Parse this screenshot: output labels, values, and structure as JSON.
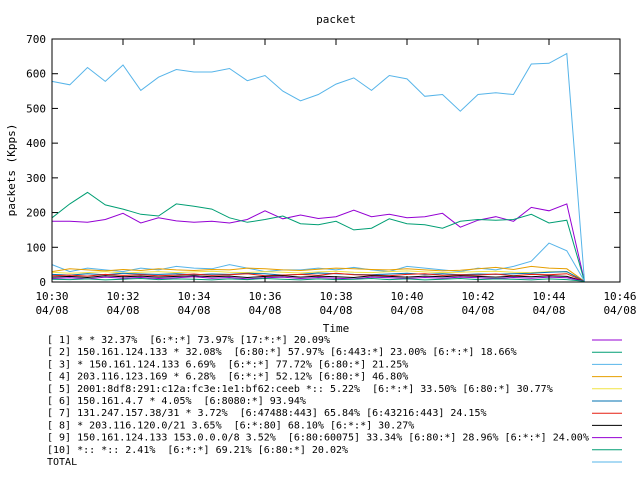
{
  "chart_data": {
    "type": "line",
    "title": "packet",
    "xlabel": "Time",
    "ylabel": "packets (Kpps)",
    "ylim": [
      0,
      700
    ],
    "yticks": [
      0,
      100,
      200,
      300,
      400,
      500,
      600,
      700
    ],
    "xlim": [
      0,
      16
    ],
    "xticks": [
      {
        "x": 0,
        "time": "10:30",
        "date": "04/08"
      },
      {
        "x": 2,
        "time": "10:32",
        "date": "04/08"
      },
      {
        "x": 4,
        "time": "10:34",
        "date": "04/08"
      },
      {
        "x": 6,
        "time": "10:36",
        "date": "04/08"
      },
      {
        "x": 8,
        "time": "10:38",
        "date": "04/08"
      },
      {
        "x": 10,
        "time": "10:40",
        "date": "04/08"
      },
      {
        "x": 12,
        "time": "10:42",
        "date": "04/08"
      },
      {
        "x": 14,
        "time": "10:44",
        "date": "04/08"
      },
      {
        "x": 16,
        "time": "10:46",
        "date": "04/08"
      }
    ],
    "x": [
      0,
      0.5,
      1,
      1.5,
      2,
      2.5,
      3,
      3.5,
      4,
      4.5,
      5,
      5.5,
      6,
      6.5,
      7,
      7.5,
      8,
      8.5,
      9,
      9.5,
      10,
      10.5,
      11,
      11.5,
      12,
      12.5,
      13,
      13.5,
      14,
      14.5,
      15
    ],
    "grid": false,
    "legend_position": "below",
    "series": [
      {
        "name": "[ 1] * * 32.37%  [6:*:*] 73.97% [17:*:*] 20.09%",
        "color": "#9400d3",
        "values": [
          175,
          175,
          172,
          180,
          198,
          170,
          185,
          176,
          172,
          175,
          170,
          180,
          205,
          182,
          193,
          183,
          188,
          207,
          188,
          195,
          185,
          188,
          198,
          158,
          178,
          188,
          175,
          215,
          205,
          225,
          2
        ]
      },
      {
        "name": "[ 2] 150.161.124.133 * 32.08%  [6:80:*] 57.97% [6:443:*] 23.00% [6:*:*] 18.66%",
        "color": "#009e73",
        "values": [
          185,
          225,
          258,
          222,
          210,
          195,
          190,
          225,
          218,
          210,
          185,
          172,
          180,
          190,
          168,
          165,
          175,
          150,
          155,
          182,
          168,
          165,
          155,
          175,
          180,
          178,
          180,
          195,
          170,
          178,
          2
        ]
      },
      {
        "name": "[ 3] * 150.161.124.133 6.69%  [6:*:*] 77.72% [6:80:*] 21.25%",
        "color": "#56b4e9",
        "values": [
          50,
          30,
          40,
          35,
          30,
          40,
          35,
          45,
          40,
          38,
          50,
          40,
          30,
          35,
          35,
          40,
          35,
          42,
          35,
          30,
          45,
          40,
          35,
          30,
          40,
          35,
          45,
          60,
          112,
          90,
          2
        ]
      },
      {
        "name": "[ 4] 203.116.123.169 * 6.28%  [6:*:*] 52.12% [6:80:*] 46.80%",
        "color": "#e69f00",
        "values": [
          30,
          38,
          35,
          32,
          36,
          33,
          38,
          35,
          33,
          36,
          35,
          40,
          38,
          35,
          33,
          37,
          40,
          38,
          36,
          35,
          38,
          35,
          32,
          34,
          38,
          42,
          36,
          45,
          40,
          38,
          2
        ]
      },
      {
        "name": "[ 5] 2001:8df8:291:c12a:fc3e:1e1:bf62:ceeb *:: 5.22%  [6:*:*] 33.50% [6:80:*] 30.77%",
        "color": "#f0e442",
        "values": [
          28,
          25,
          27,
          30,
          26,
          28,
          30,
          27,
          29,
          31,
          28,
          27,
          30,
          28,
          26,
          29,
          31,
          28,
          27,
          30,
          32,
          29,
          27,
          28,
          30,
          31,
          28,
          27,
          30,
          29,
          2
        ]
      },
      {
        "name": "[ 6] 150.161.4.7 * 4.05%  [6:8080:*] 93.94%",
        "color": "#0072b2",
        "values": [
          22,
          20,
          24,
          21,
          25,
          23,
          22,
          24,
          21,
          23,
          22,
          25,
          24,
          20,
          22,
          26,
          24,
          22,
          21,
          23,
          25,
          22,
          24,
          21,
          23,
          22,
          24,
          25,
          28,
          30,
          2
        ]
      },
      {
        "name": "[ 7] 131.247.157.38/31 * 3.72%  [6:47488:443] 65.84% [6:43216:443] 24.15%",
        "color": "#e51e10",
        "values": [
          18,
          20,
          17,
          22,
          19,
          21,
          18,
          20,
          23,
          19,
          21,
          24,
          18,
          20,
          22,
          19,
          25,
          21,
          20,
          18,
          22,
          24,
          19,
          21,
          20,
          23,
          18,
          22,
          21,
          24,
          2
        ]
      },
      {
        "name": "[ 8] * 203.116.120.0/21 3.65%  [6:*:80] 68.10% [6:*:*] 30.27%",
        "color": "#000000",
        "values": [
          14,
          16,
          13,
          18,
          15,
          17,
          14,
          16,
          18,
          15,
          17,
          13,
          16,
          18,
          14,
          17,
          15,
          13,
          18,
          16,
          14,
          17,
          15,
          18,
          16,
          14,
          17,
          15,
          18,
          16,
          2
        ]
      },
      {
        "name": "[ 9] 150.161.124.133 153.0.0.0/8 3.52%  [6:80:60075] 33.34% [6:80:*] 28.96% [6:*:*] 24.00%",
        "color": "#9400d3",
        "values": [
          10,
          12,
          9,
          14,
          11,
          13,
          10,
          12,
          15,
          11,
          13,
          9,
          12,
          14,
          10,
          13,
          11,
          9,
          14,
          12,
          10,
          13,
          11,
          14,
          12,
          10,
          13,
          11,
          14,
          12,
          2
        ]
      },
      {
        "name": "[10] *:: *:: 2.41%  [6:*:*] 69.21% [6:80:*] 20.02%",
        "color": "#009e73",
        "values": [
          8,
          7,
          9,
          6,
          8,
          10,
          7,
          9,
          8,
          6,
          9,
          7,
          10,
          8,
          6,
          9,
          7,
          8,
          10,
          7,
          9,
          6,
          8,
          10,
          7,
          9,
          8,
          6,
          9,
          7,
          2
        ]
      },
      {
        "name": "TOTAL",
        "color": "#56b4e9",
        "values": [
          578,
          568,
          618,
          578,
          625,
          552,
          590,
          612,
          605,
          605,
          615,
          580,
          595,
          550,
          522,
          540,
          570,
          588,
          552,
          595,
          585,
          535,
          540,
          492,
          540,
          545,
          540,
          628,
          630,
          658,
          2
        ]
      }
    ]
  }
}
